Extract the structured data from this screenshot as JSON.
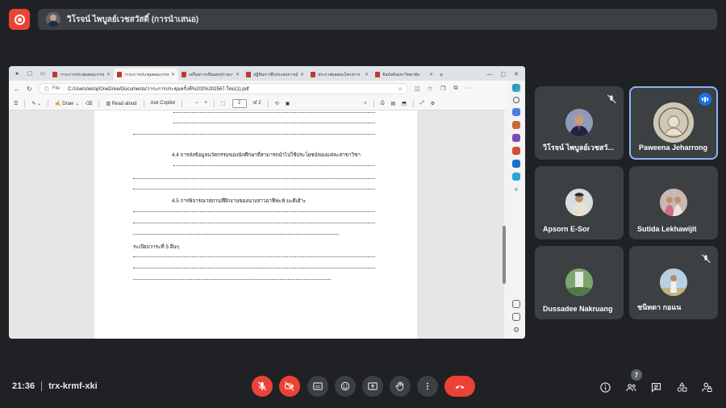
{
  "presenter": {
    "name": "วิโรจน์ ไพบูลย์เวชสวัสดิ์ (การนำเสนอ)"
  },
  "browser": {
    "tabs": [
      {
        "title": "วาระการประชุมคณะกรรมการ",
        "active": false
      },
      {
        "title": "วาระการประชุมคณะกรรมการ",
        "active": true
      },
      {
        "title": "เครื่องการเขียนสรุปรายงาน",
        "active": false
      },
      {
        "title": "ปฏิทินการฝึกประสบการณ์",
        "active": false
      },
      {
        "title": "ประกาศผลสอบโครงการ",
        "active": false
      },
      {
        "title": "ข้อบังคับมหาวิทยาลัย",
        "active": false
      }
    ],
    "address_scheme": "File",
    "address": "C:/Users/wiroj/OneDrive/Documents/วาระการประชุมครั้งที่%202%202567-ใหม่(1).pdf"
  },
  "pdf_toolbar": {
    "draw": "Draw",
    "read_aloud": "Read aloud",
    "ask_copilot": "Ask Copilot",
    "page_current": "2",
    "page_total": "of 2"
  },
  "document": {
    "section_4_4": "4.4 การส่งข้อมูลนวัตกรรมของนักศึกษาที่สามารถนำไปใช้ประโยชน์ของแต่ละสาขาวิชา",
    "section_4_5": "4.5 การพิจารณาสถานที่ฝึกงานของนางสาวอาฟีฟะห์ มะดีเย๊าะ",
    "agenda_5": "ระเบียบวาระที่ 5 อื่นๆ"
  },
  "participants": [
    {
      "name": "วิโรจน์ ไพบูลย์เวชสวั...",
      "muted": true,
      "speaking": false
    },
    {
      "name": "Paweena Jeharrong",
      "muted": false,
      "speaking": true
    },
    {
      "name": "Apsorn E-Sor",
      "muted": false,
      "speaking": false
    },
    {
      "name": "Sutida Lekhawijit",
      "muted": false,
      "speaking": false
    },
    {
      "name": "Dussadee Nakruang",
      "muted": false,
      "speaking": false
    },
    {
      "name": "ชนิทดา กอแน",
      "muted": true,
      "speaking": false
    }
  ],
  "meeting": {
    "time": "21:36",
    "code": "trx-krmf-xki",
    "people_count": "7"
  },
  "colors": {
    "background": "#202124",
    "tile": "#3c4043",
    "danger": "#ea4335",
    "speaking": "#8ab4f8"
  }
}
